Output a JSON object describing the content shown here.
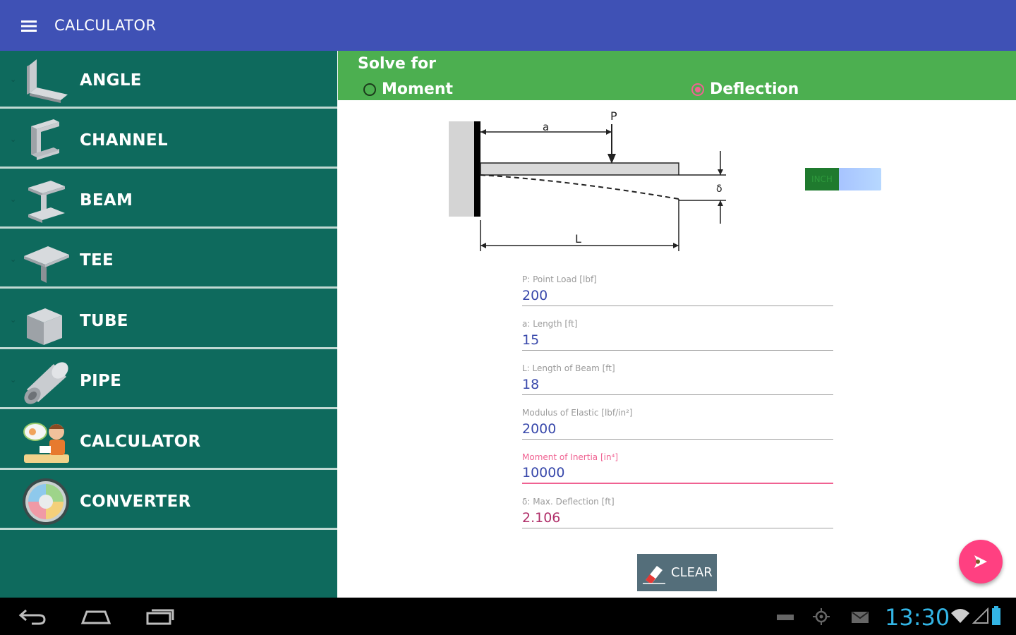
{
  "appbar": {
    "title": "CALCULATOR",
    "menu_icon": "menu-icon",
    "background": "#3f51b5"
  },
  "sidebar": {
    "background": "#0e6a5d",
    "items": [
      {
        "label": "ANGLE",
        "icon": "angle-icon"
      },
      {
        "label": "CHANNEL",
        "icon": "channel-icon"
      },
      {
        "label": "BEAM",
        "icon": "beam-icon"
      },
      {
        "label": "TEE",
        "icon": "tee-icon"
      },
      {
        "label": "TUBE",
        "icon": "tube-icon"
      },
      {
        "label": "PIPE",
        "icon": "pipe-icon"
      },
      {
        "label": "CALCULATOR",
        "icon": "calculator-icon"
      },
      {
        "label": "CONVERTER",
        "icon": "converter-icon"
      }
    ]
  },
  "solve": {
    "title": "Solve for",
    "options": [
      {
        "label": "Moment",
        "checked": false
      },
      {
        "label": "Deflection",
        "checked": true
      }
    ],
    "accent": "#4caf50"
  },
  "diagram": {
    "load_label": "P",
    "a_label": "a",
    "L_label": "L",
    "delta_label": "δ"
  },
  "unit_toggle": {
    "label": "INCH"
  },
  "fields": [
    {
      "label": "P: Point Load [lbf]",
      "value": "200",
      "state": "normal"
    },
    {
      "label": "a: Length [ft]",
      "value": "15",
      "state": "normal"
    },
    {
      "label": "L: Length of Beam [ft]",
      "value": "18",
      "state": "normal"
    },
    {
      "label": "Modulus of Elastic [lbf/in²]",
      "value": "2000",
      "state": "normal"
    },
    {
      "label": "Moment of Inertia [in⁴]",
      "value": "10000",
      "state": "focused"
    },
    {
      "label": "δ: Max. Deflection [ft]",
      "value": "2.106",
      "state": "result"
    }
  ],
  "clear_button": {
    "label": "CLEAR",
    "icon": "eraser-icon"
  },
  "fab": {
    "icon": "share-icon",
    "color": "#ff4081"
  },
  "status": {
    "time": "13:30"
  },
  "navbar": {
    "back_icon": "back-icon",
    "home_icon": "home-icon",
    "recents_icon": "recents-icon"
  }
}
